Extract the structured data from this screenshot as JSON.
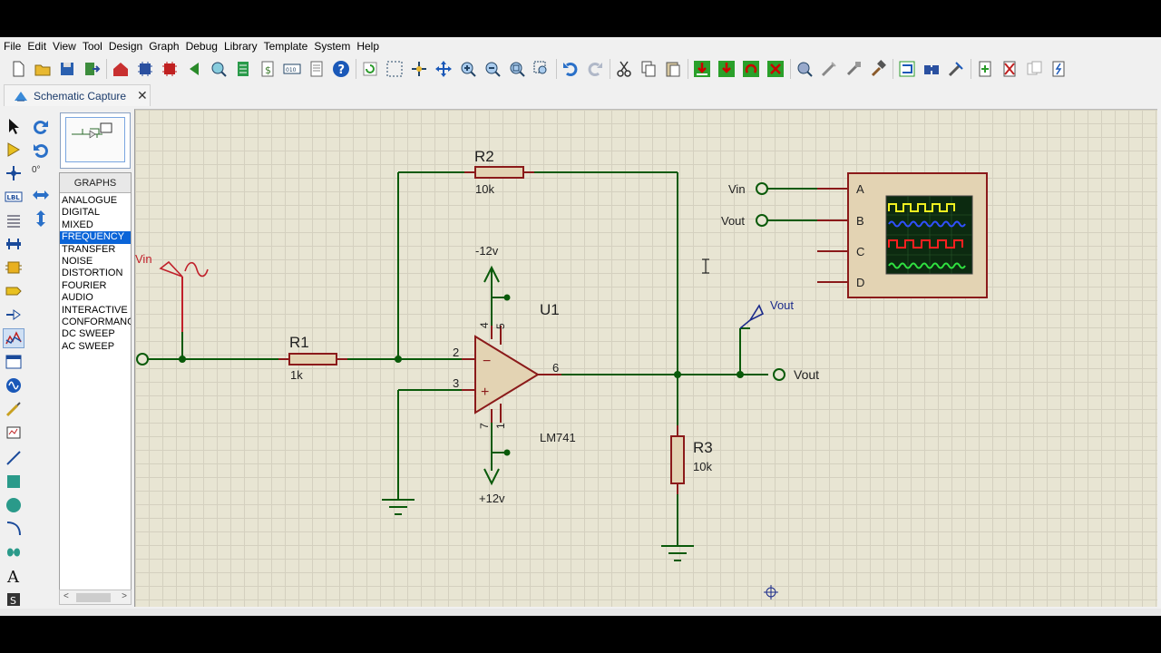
{
  "menu": [
    "File",
    "Edit",
    "View",
    "Tool",
    "Design",
    "Graph",
    "Debug",
    "Library",
    "Template",
    "System",
    "Help"
  ],
  "tab": {
    "title": "Schematic Capture",
    "close": "✕"
  },
  "rotation": "0°",
  "graphs": {
    "header": "GRAPHS",
    "items": [
      "ANALOGUE",
      "DIGITAL",
      "MIXED",
      "FREQUENCY",
      "TRANSFER",
      "NOISE",
      "DISTORTION",
      "FOURIER",
      "AUDIO",
      "INTERACTIVE",
      "CONFORMANC",
      "DC SWEEP",
      "AC SWEEP"
    ],
    "selected": "FREQUENCY"
  },
  "scroll": {
    "left": "<",
    "right": ">"
  },
  "schematic": {
    "r1": {
      "name": "R1",
      "value": "1k"
    },
    "r2": {
      "name": "R2",
      "value": "10k"
    },
    "r3": {
      "name": "R3",
      "value": "10k"
    },
    "opamp": {
      "ref": "U1",
      "part": "LM741",
      "pin2": "2",
      "pin3": "3",
      "pin4": "4",
      "pin5": "5",
      "pin6": "6",
      "pin7": "7",
      "pin1": "1",
      "minus": "−",
      "plus": "+"
    },
    "supply_neg": "-12v",
    "supply_pos": "+12v",
    "probe_in": "Vin",
    "probe_out": "Vout",
    "terminal_out": "Vout",
    "scope": {
      "label_in": "Vin",
      "label_out": "Vout",
      "channels": [
        "A",
        "B",
        "C",
        "D"
      ]
    }
  },
  "colors": {
    "wire": "#0a5a0a",
    "component": "#8b1a1a",
    "component_fill": "#e3d3b3",
    "probe_in": "#c0202a",
    "probe_out": "#1a2a8a",
    "canvas": "#e8e5d3"
  }
}
